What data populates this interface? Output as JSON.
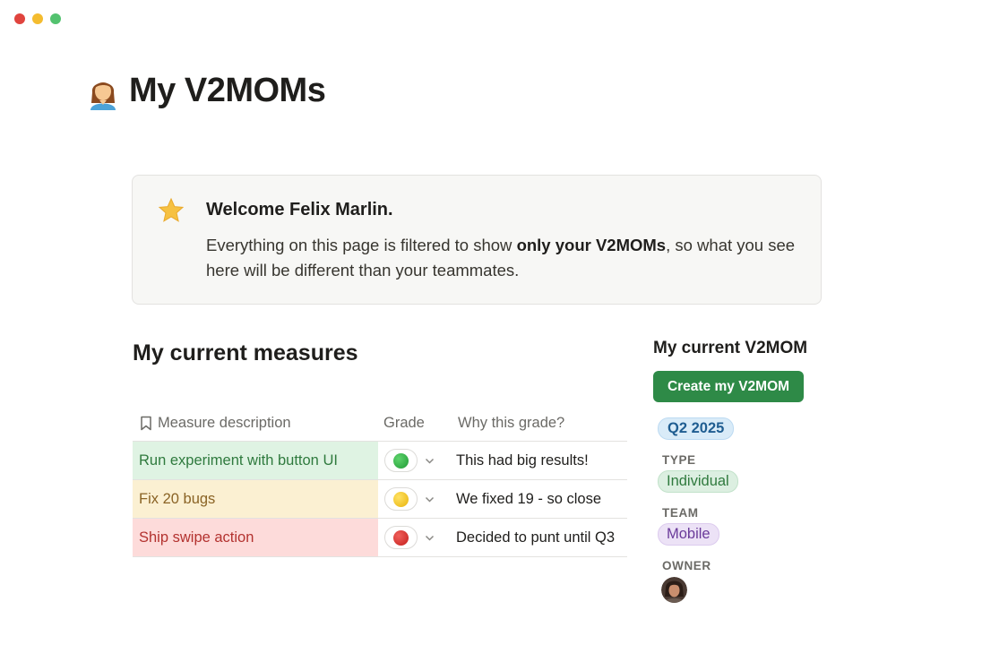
{
  "window": {
    "controls": [
      "close",
      "minimize",
      "maximize"
    ]
  },
  "page": {
    "icon": "person-emoji-icon",
    "title": "My V2MOMs"
  },
  "callout": {
    "icon": "star-icon",
    "title": "Welcome Felix Marlin.",
    "body_before": "Everything on this page is filtered to show ",
    "body_bold": "only your V2MOMs",
    "body_after": ", so what you see here will be different than your teammates."
  },
  "measures": {
    "heading": "My current measures",
    "columns": {
      "description": "Measure description",
      "grade": "Grade",
      "why": "Why this grade?"
    },
    "rows": [
      {
        "description": "Run experiment with button UI",
        "grade": "green",
        "grade_color": "#2ea043",
        "why": "This had big results!"
      },
      {
        "description": "Fix 20 bugs",
        "grade": "yellow",
        "grade_color": "#f2c40f",
        "why": "We fixed 19 - so close"
      },
      {
        "description": "Ship swipe action",
        "grade": "red",
        "grade_color": "#d62f2b",
        "why": "Decided to punt until Q3"
      }
    ]
  },
  "sidebar": {
    "title": "My current V2MOM",
    "create_button": "Create my V2MOM",
    "period": "Q2 2025",
    "type_label": "TYPE",
    "type_value": "Individual",
    "team_label": "TEAM",
    "team_value": "Mobile",
    "owner_label": "OWNER",
    "owner_avatar": "avatar"
  },
  "colors": {
    "accent_button": "#2e8a47",
    "green_row": "#dff3e3",
    "yellow_row": "#fbf0d2",
    "red_row": "#fddbda"
  }
}
